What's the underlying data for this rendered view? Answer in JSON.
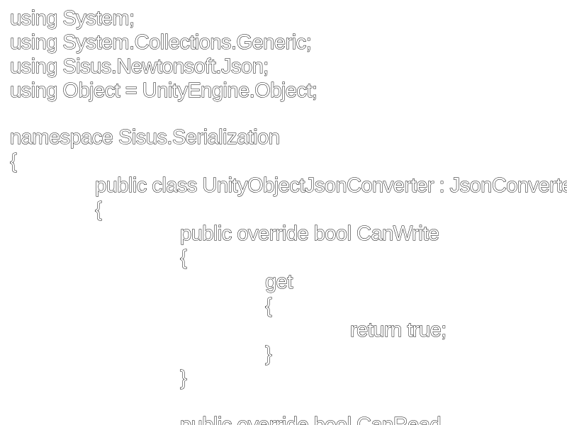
{
  "code": {
    "lines": [
      "using System;",
      "using System.Collections.Generic;",
      "using Sisus.Newtonsoft.Json;",
      "using Object = UnityEngine.Object;",
      "",
      "namespace Sisus.Serialization",
      "{",
      "public class UnityObjectJsonConverter : JsonConverter",
      "{",
      "public override bool CanWrite",
      "{",
      "get",
      "{",
      "return true;",
      "}",
      "}",
      "",
      "public override bool CanRead"
    ]
  }
}
